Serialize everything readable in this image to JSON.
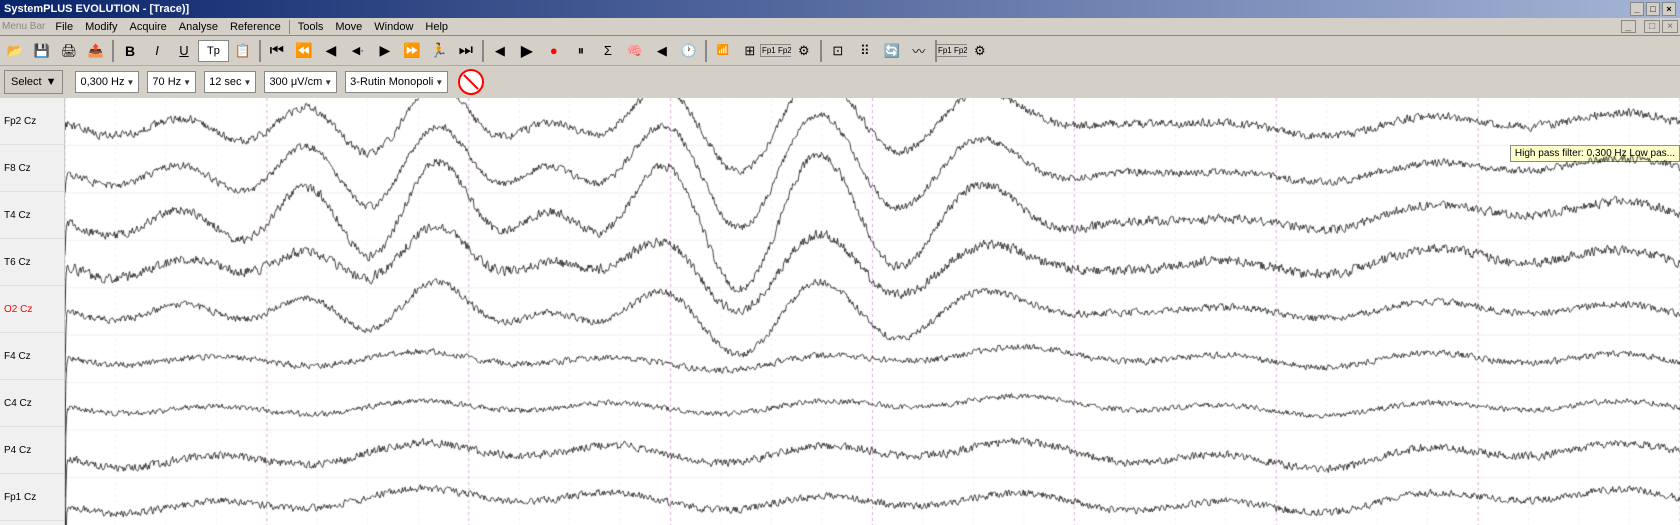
{
  "app": {
    "title": "SystemPLUS EVOLUTION - [Trace)]",
    "title_short": "SystemPLUS EVOLUTION"
  },
  "title_bar": {
    "left": "SystemPLUS EVOLUTION - [Trace)]",
    "buttons": [
      "_",
      "□",
      "×"
    ]
  },
  "menu_bar": {
    "label": "Menu Bar",
    "items": [
      "File",
      "Modify",
      "Acquire",
      "Analyse",
      "Reference",
      "Tools",
      "Move",
      "Window",
      "Help"
    ]
  },
  "toolbar2": {
    "select_label": "Select",
    "filter_low": "0,300 Hz",
    "filter_high": "70 Hz",
    "time_scale": "12 sec",
    "amplitude_scale": "300 μV/cm",
    "montage": "3-Rutin Monopoli"
  },
  "channels": [
    {
      "label": "Fp2 Cz",
      "red": false
    },
    {
      "label": "F8 Cz",
      "red": false
    },
    {
      "label": "T4 Cz",
      "red": false
    },
    {
      "label": "T6 Cz",
      "red": false
    },
    {
      "label": "O2 Cz",
      "red": true
    },
    {
      "label": "F4 Cz",
      "red": false
    },
    {
      "label": "C4 Cz",
      "red": false
    },
    {
      "label": "P4 Cz",
      "red": false
    },
    {
      "label": "Fp1 Cz",
      "red": false
    }
  ],
  "tooltip": {
    "text": "High pass filter: 0,300 Hz   Low pas..."
  },
  "grid": {
    "vertical_lines": 32
  }
}
